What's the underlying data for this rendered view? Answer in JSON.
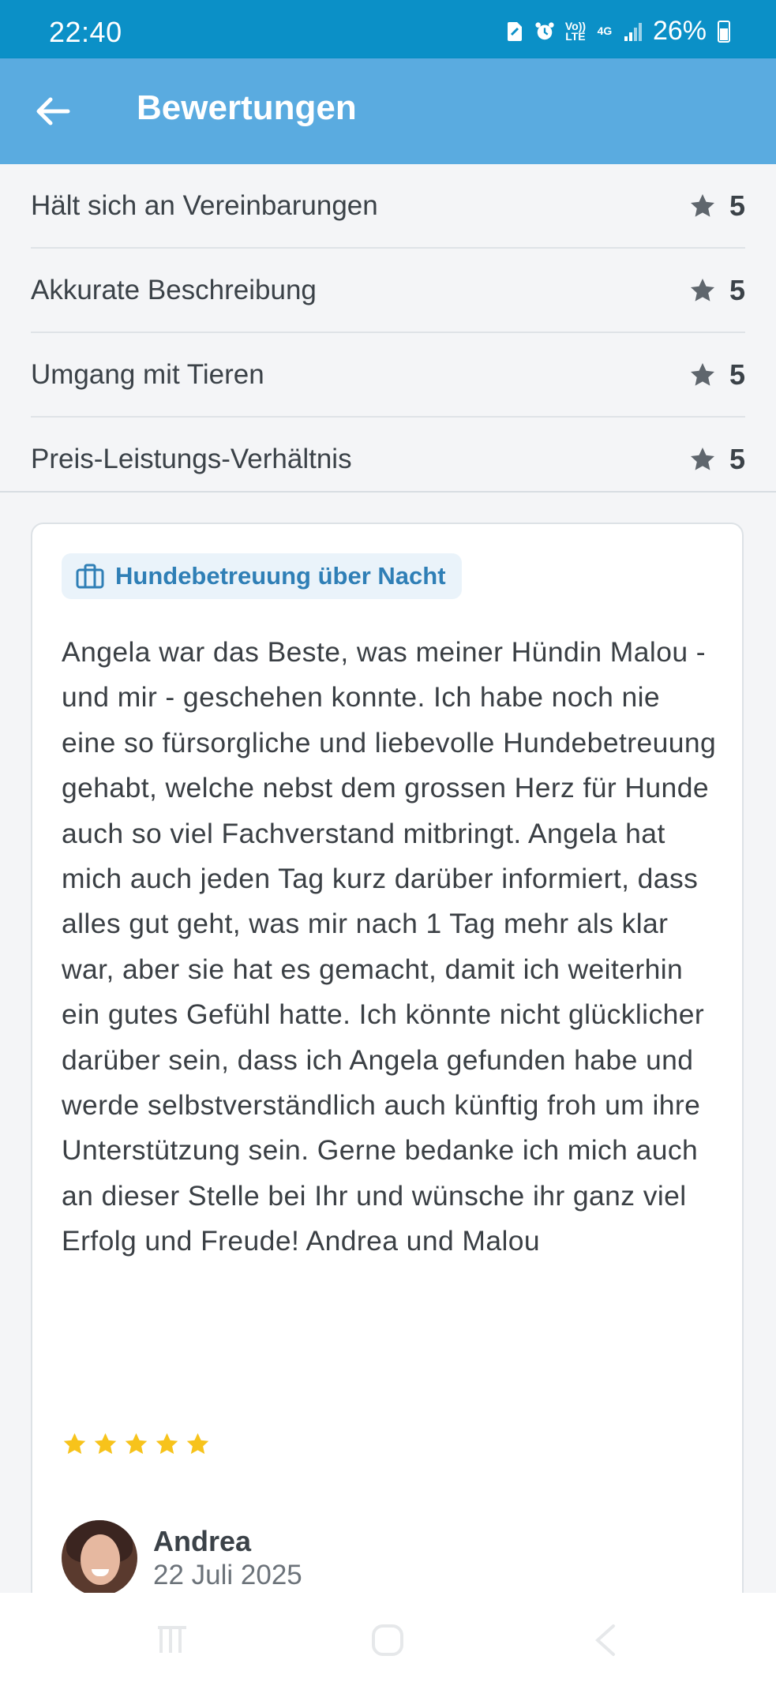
{
  "status_bar": {
    "time": "22:40",
    "battery": "26%",
    "icons": [
      "sim-icon",
      "alarm-icon",
      "volte-icon",
      "4g-icon",
      "signal-icon",
      "battery-icon"
    ],
    "volte_label": "Vo)) LTE",
    "network_label": "4G"
  },
  "header": {
    "title": "Bewertungen",
    "back_icon": "arrow-left-icon"
  },
  "category_ratings": [
    {
      "label": "Hält sich an Vereinbarungen",
      "score": "5"
    },
    {
      "label": "Akkurate Beschreibung",
      "score": "5"
    },
    {
      "label": "Umgang mit Tieren",
      "score": "5"
    },
    {
      "label": "Preis-Leistungs-Verhältnis",
      "score": "5"
    }
  ],
  "review": {
    "service_tag": "Hundebetreuung über Nacht",
    "text": "Angela war das Beste, was meiner Hündin Malou - und mir - geschehen konnte. Ich habe noch nie eine so fürsorgliche und liebevolle Hundebetreuung gehabt, welche nebst dem grossen Herz für Hunde auch so viel Fachverstand mitbringt. Angela hat mich auch jeden Tag kurz darüber informiert, dass alles gut geht, was mir nach 1 Tag mehr als klar war, aber sie hat es gemacht, damit ich weiterhin ein gutes Gefühl hatte. Ich könnte nicht glücklicher darüber sein, dass ich Angela gefunden habe und werde selbstverständlich auch künftig froh um ihre Unterstützung sein. Gerne bedanke ich mich auch an dieser Stelle bei Ihr und wünsche ihr ganz viel Erfolg und Freude! Andrea und Malou",
    "stars": 5,
    "author": "Andrea",
    "date": "22 Juli 2025"
  },
  "colors": {
    "status_bar": "#0b90c7",
    "app_bar": "#5aabe0",
    "star_yellow": "#f7c31b",
    "star_grey": "#5f666d",
    "tag_text": "#2f7fb6",
    "tag_bg": "#eaf3fa"
  },
  "nav_bar": [
    "recents-icon",
    "home-icon",
    "back-icon"
  ]
}
